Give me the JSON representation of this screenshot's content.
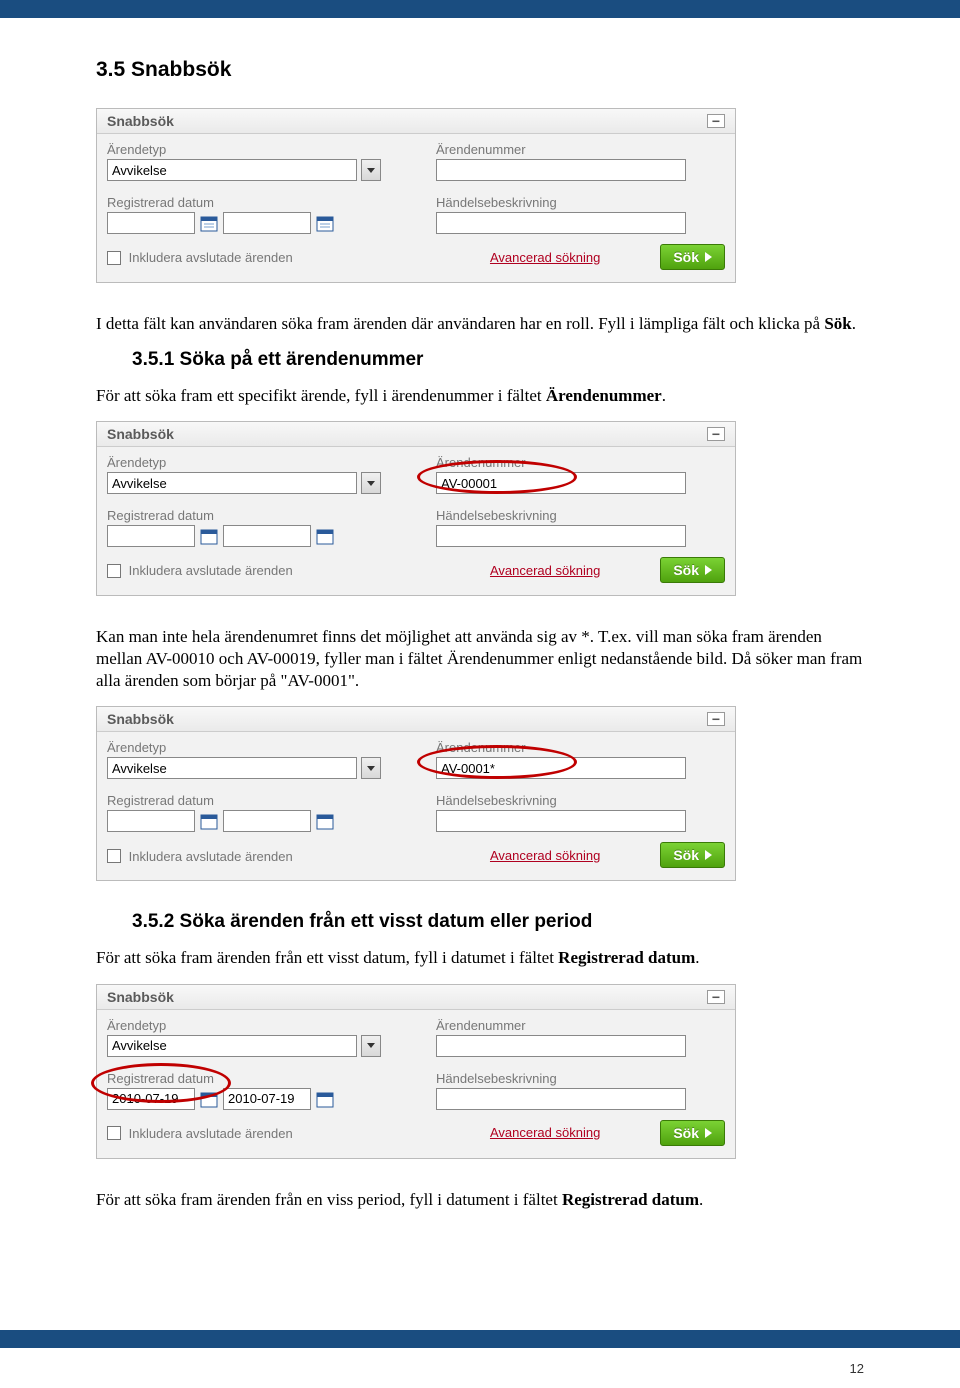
{
  "headings": {
    "h2": "3.5 Snabbsök",
    "h3_1": "3.5.1 Söka på ett ärendenummer",
    "h3_2": "3.5.2 Söka ärenden från ett visst datum eller period"
  },
  "paragraphs": {
    "p1a": "I detta fält kan användaren söka fram ärenden där användaren har en roll. Fyll i lämpliga fält och klicka på ",
    "p1b": "Sök",
    "p1c": ".",
    "p2a": "För att söka fram ett specifikt ärende, fyll i ärendenummer i fältet ",
    "p2b": "Ärendenummer",
    "p2c": ".",
    "p3": "Kan man inte hela ärendenumret finns det möjlighet att använda sig av *. T.ex. vill man söka fram ärenden mellan AV-00010 och AV-00019, fyller man i fältet Ärendenummer enligt nedanstående bild. Då söker man fram alla ärenden som börjar på \"AV-0001\".",
    "p4a": "För att söka fram ärenden från ett visst datum, fyll i datumet i fältet ",
    "p4b": "Registrerad datum",
    "p4c": ".",
    "p5a": "För att söka fram ärenden från en viss period, fyll i datument i fältet ",
    "p5b": "Registrerad datum",
    "p5c": "."
  },
  "panel": {
    "title": "Snabbsök",
    "labels": {
      "arendetyp": "Ärendetyp",
      "arendenummer": "Ärendenummer",
      "registrerad": "Registrerad datum",
      "beskrivning": "Händelsebeskrivning",
      "inkludera": "Inkludera avslutade ärenden"
    },
    "advanced_link": "Avancerad sökning",
    "search_button": "Sök",
    "arendetyp_value": "Avvikelse"
  },
  "values": {
    "arendenummer_2": "AV-00001",
    "arendenummer_3": "AV-0001*",
    "date_from": "2010-07-19",
    "date_to": "2010-07-19"
  },
  "page_number": "12"
}
